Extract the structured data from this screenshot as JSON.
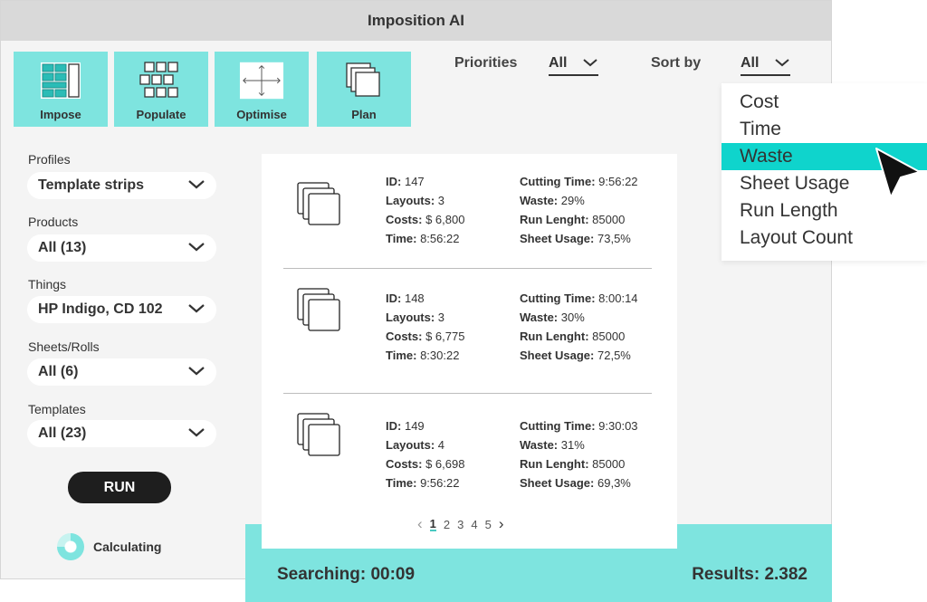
{
  "window": {
    "title": "Imposition AI"
  },
  "tools": [
    {
      "label": "Impose",
      "icon": "impose-icon"
    },
    {
      "label": "Populate",
      "icon": "populate-icon"
    },
    {
      "label": "Optimise",
      "icon": "optimise-icon"
    },
    {
      "label": "Plan",
      "icon": "plan-icon"
    }
  ],
  "filters": {
    "priorities_label": "Priorities",
    "priorities_value": "All",
    "sortby_label": "Sort by",
    "sortby_value": "All"
  },
  "sort_options": [
    "Cost",
    "Time",
    "Waste",
    "Sheet Usage",
    "Run Length",
    "Layout Count"
  ],
  "sort_selected": "Waste",
  "sidebar": {
    "profiles": {
      "label": "Profiles",
      "value": "Template strips"
    },
    "products": {
      "label": "Products",
      "value": "All (13)"
    },
    "things": {
      "label": "Things",
      "value": "HP Indigo, CD 102"
    },
    "sheets": {
      "label": "Sheets/Rolls",
      "value": "All (6)"
    },
    "templates": {
      "label": "Templates",
      "value": "All (23)"
    },
    "run": "RUN",
    "status": "Calculating"
  },
  "result_labels": {
    "id": "ID:",
    "layouts": "Layouts:",
    "costs": "Costs:",
    "time": "Time:",
    "cutting": "Cutting Time:",
    "waste": "Waste:",
    "run": "Run Lenght:",
    "sheet": "Sheet Usage:"
  },
  "results": [
    {
      "id": "147",
      "layouts": "3",
      "costs": "$ 6,800",
      "time": "8:56:22",
      "cutting": "9:56:22",
      "waste": "29%",
      "run": "85000",
      "sheet": "73,5%"
    },
    {
      "id": "148",
      "layouts": "3",
      "costs": "$ 6,775",
      "time": "8:30:22",
      "cutting": "8:00:14",
      "waste": "30%",
      "run": "85000",
      "sheet": "72,5%"
    },
    {
      "id": "149",
      "layouts": "4",
      "costs": "$ 6,698",
      "time": "9:56:22",
      "cutting": "9:30:03",
      "waste": "31%",
      "run": "85000",
      "sheet": "69,3%"
    }
  ],
  "pagination": {
    "prev": "‹",
    "pages": [
      "1",
      "2",
      "3",
      "4",
      "5"
    ],
    "current": "1",
    "next": "›"
  },
  "footer": {
    "searching": "Searching: 00:09",
    "results": "Results: 2.382"
  },
  "colors": {
    "accent": "#7ee4df",
    "selected": "#0fd4cc",
    "dark": "#1e1e1e"
  }
}
